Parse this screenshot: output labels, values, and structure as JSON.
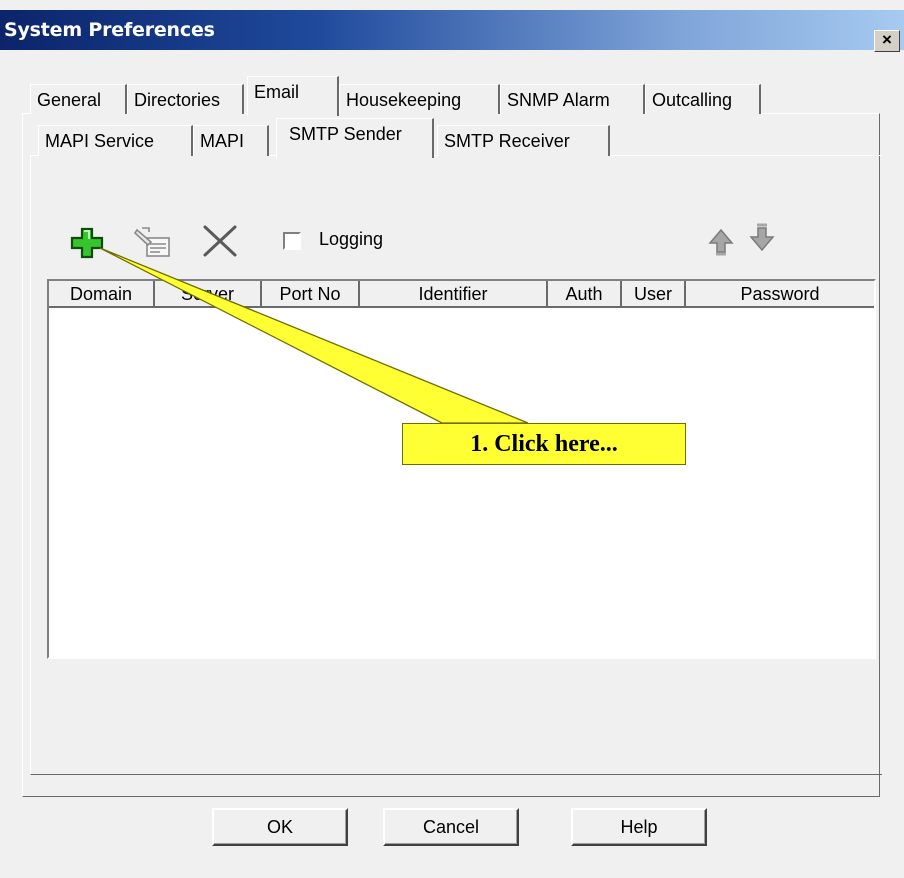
{
  "window": {
    "title": "System Preferences",
    "close_glyph": "×"
  },
  "tabs_top": [
    "General",
    "Directories",
    "Email",
    "Housekeeping",
    "SNMP Alarm",
    "Outcalling"
  ],
  "tabs_email": [
    "MAPI Service",
    "MAPI",
    "SMTP Sender",
    "SMTP Receiver"
  ],
  "toolbar": {
    "add_icon": "green-plus-icon",
    "edit_icon": "edit-entry-icon",
    "delete_icon": "delete-x-icon",
    "logging_label": "Logging",
    "logging_checked": false,
    "up_icon": "move-up-icon",
    "down_icon": "move-down-icon"
  },
  "table": {
    "columns": [
      "Domain",
      "Server",
      "Port No",
      "Identifier",
      "Auth",
      "User",
      "Password"
    ],
    "rows": []
  },
  "buttons": {
    "ok": "OK",
    "cancel": "Cancel",
    "help": "Help"
  },
  "annotation": {
    "text": "1. Click here...",
    "color": "#ffff33"
  }
}
